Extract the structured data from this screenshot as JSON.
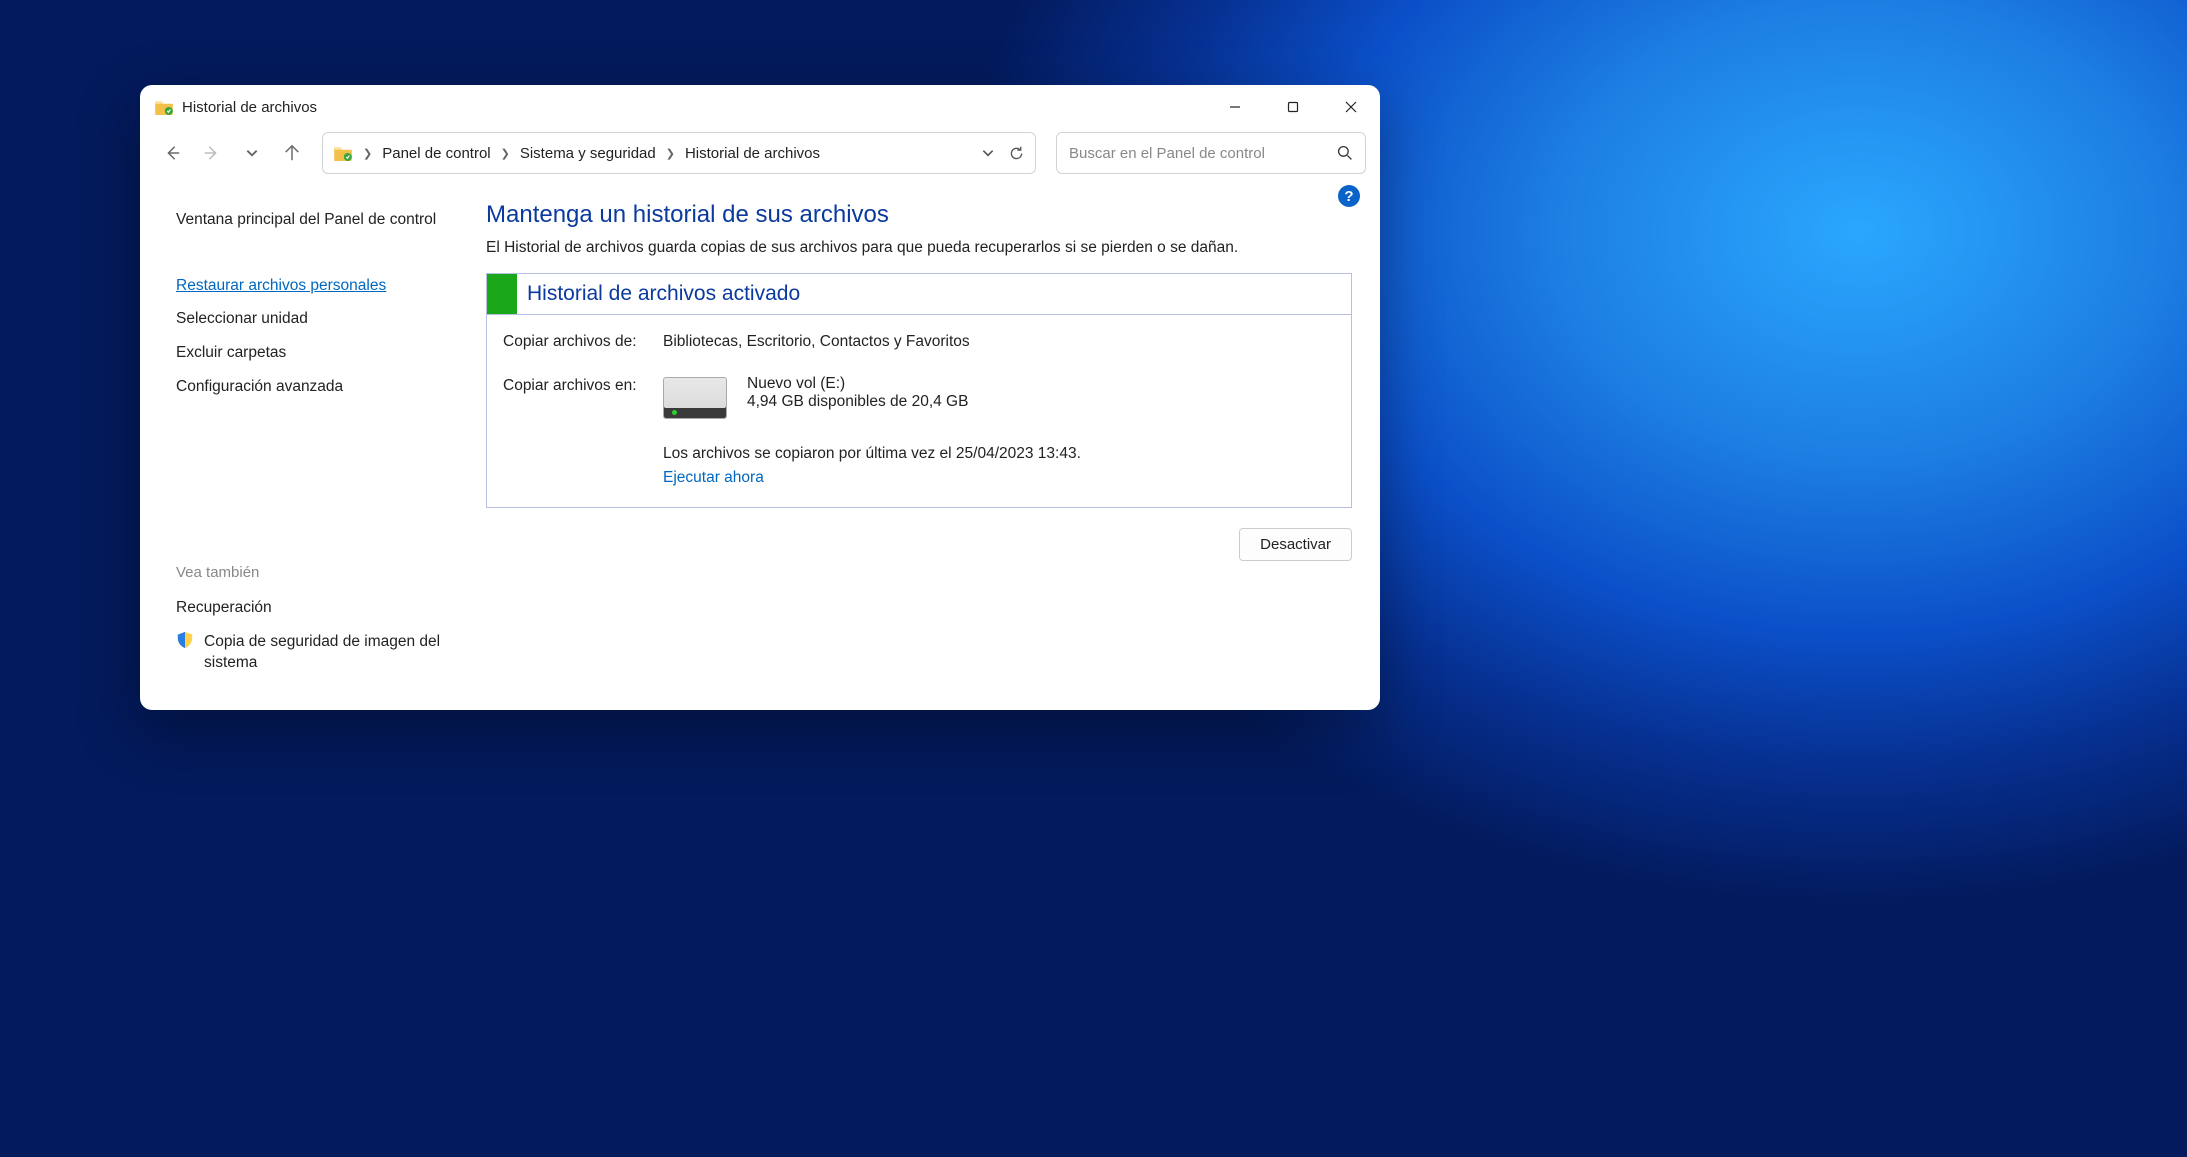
{
  "window": {
    "title": "Historial de archivos"
  },
  "breadcrumbs": {
    "b0": "Panel de control",
    "b1": "Sistema y seguridad",
    "b2": "Historial de archivos"
  },
  "search": {
    "placeholder": "Buscar en el Panel de control"
  },
  "sidebar": {
    "main": "Ventana principal del Panel de control",
    "restore": "Restaurar archivos personales",
    "select_drive": "Seleccionar unidad",
    "exclude": "Excluir carpetas",
    "advanced": "Configuración avanzada"
  },
  "seealso": {
    "header": "Vea también",
    "recovery": "Recuperación",
    "system_image": "Copia de seguridad de imagen del sistema"
  },
  "main": {
    "heading": "Mantenga un historial de sus archivos",
    "sub": "El Historial de archivos guarda copias de sus archivos para que pueda recuperarlos si se pierden o se dañan.",
    "status_title": "Historial de archivos activado",
    "copy_from_label": "Copiar archivos de:",
    "copy_from_value": "Bibliotecas, Escritorio, Contactos y Favoritos",
    "copy_to_label": "Copiar archivos en:",
    "drive_name": "Nuevo vol (E:)",
    "drive_space": "4,94 GB disponibles de 20,4 GB",
    "last_copy": "Los archivos se copiaron por última vez el 25/04/2023 13:43.",
    "run_now": "Ejecutar ahora",
    "deactivate": "Desactivar"
  },
  "help": "?"
}
